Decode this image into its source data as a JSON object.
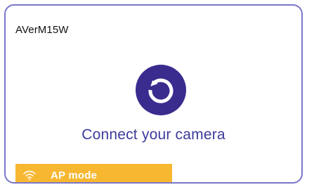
{
  "device": {
    "name": "AVerM15W"
  },
  "connect": {
    "label": "Connect your camera",
    "icon": "refresh-icon"
  },
  "mode": {
    "label": "AP mode",
    "icon": "wifi-icon",
    "color": "#f7b731"
  },
  "colors": {
    "accent": "#3a2b8e",
    "border": "#7b77c9",
    "text_accent": "#3d3a9b"
  }
}
